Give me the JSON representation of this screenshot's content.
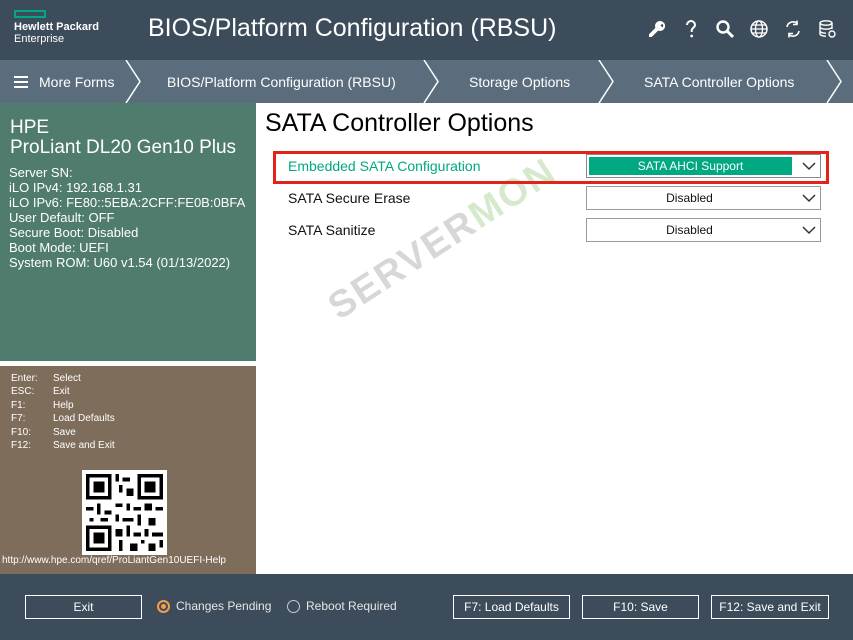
{
  "header": {
    "logo_line1": "Hewlett Packard",
    "logo_line2": "Enterprise",
    "title": "BIOS/Platform Configuration (RBSU)",
    "icons": [
      "wrench-icon",
      "help-icon",
      "search-icon",
      "globe-icon",
      "refresh-icon",
      "database-icon"
    ]
  },
  "breadcrumb": {
    "items": [
      {
        "label": "More Forms",
        "icon": "hamburger-icon"
      },
      {
        "label": "BIOS/Platform Configuration (RBSU)"
      },
      {
        "label": "Storage Options"
      },
      {
        "label": "SATA Controller Options"
      }
    ]
  },
  "system_info": {
    "vendor": "HPE",
    "model": "ProLiant DL20 Gen10 Plus",
    "lines": [
      "Server SN:",
      "iLO IPv4: 192.168.1.31",
      "iLO IPv6: FE80::5EBA:2CFF:FE0B:0BFA",
      "User Default: OFF",
      "Secure Boot: Disabled",
      "Boot Mode: UEFI",
      "System ROM: U60 v1.54 (01/13/2022)"
    ]
  },
  "help": {
    "keys": [
      {
        "key": "Enter:",
        "action": "Select"
      },
      {
        "key": "ESC:",
        "action": "Exit"
      },
      {
        "key": "F1:",
        "action": "Help"
      },
      {
        "key": "F7:",
        "action": "Load Defaults"
      },
      {
        "key": "F10:",
        "action": "Save"
      },
      {
        "key": "F12:",
        "action": "Save and Exit"
      }
    ],
    "url": "http://www.hpe.com/qref/ProLiantGen10UEFI-Help"
  },
  "main": {
    "title": "SATA Controller Options",
    "settings": [
      {
        "label": "Embedded SATA Configuration",
        "value": "SATA AHCI Support",
        "highlighted": true
      },
      {
        "label": "SATA Secure Erase",
        "value": "Disabled",
        "highlighted": false
      },
      {
        "label": "SATA Sanitize",
        "value": "Disabled",
        "highlighted": false
      }
    ],
    "watermark_part1": "SERVER",
    "watermark_part2": "MON"
  },
  "footer": {
    "exit_label": "Exit",
    "radio_pending": "Changes Pending",
    "radio_reboot": "Reboot Required",
    "f7_label": "F7: Load Defaults",
    "f10_label": "F10: Save",
    "f12_label": "F12: Save and Exit",
    "pending_selected": true
  },
  "colors": {
    "header_bg": "#3d4c5b",
    "breadcrumb_bg": "#5b6d7d",
    "info_bg": "#4f7c6d",
    "help_bg": "#7f6d5b",
    "accent_green": "#01a982",
    "highlight_red": "#e2231a",
    "radio_orange": "#f29e4a"
  }
}
